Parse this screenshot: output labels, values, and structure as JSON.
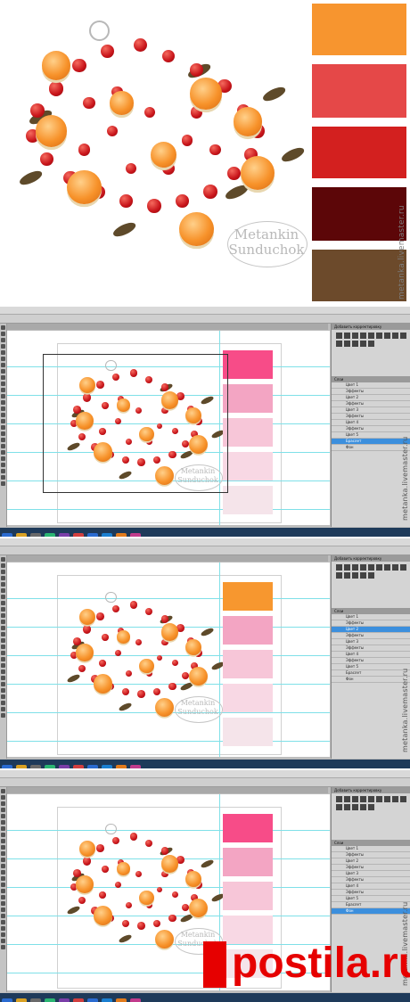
{
  "hero": {
    "swatch_colors": [
      "#f7952f",
      "#e54848",
      "#d3201f",
      "#5c0608",
      "#6c4a2b"
    ],
    "signature_line1": "Metankin",
    "signature_line2": "Sunduchok",
    "watermark": "metanka.livemaster.ru"
  },
  "photoshop": {
    "menu": [
      "Файл",
      "Редактирование",
      "Изображение",
      "Слои",
      "Выделение",
      "Фильтр",
      "Анализ",
      "3D",
      "Просмотр",
      "Окно",
      "Справка"
    ],
    "doc_tab": "Браслет цветочный @ 50% (Кривые, RGB/8)",
    "adjust_panel_title": "Добавить корректировку",
    "layers_panel_title": "Слои",
    "layer_names": [
      "Цвет 1",
      "Эффекты",
      "Цвет 2",
      "Эффекты",
      "Цвет 3",
      "Эффекты",
      "Цвет 4",
      "Эффекты",
      "Цвет 5",
      "Браслет",
      "Фон"
    ],
    "swatch_pinks": [
      "#f74c88",
      "#f3a5c3",
      "#f7c6d8",
      "#f8d8e4",
      "#f5e4ea"
    ],
    "swatch_orange": "#f7972f",
    "watermark": "metanka.livemaster.ru",
    "signature_line1": "Metankin",
    "signature_line2": "Sunduchok"
  },
  "footer": {
    "logo_text": "postila.ru"
  }
}
